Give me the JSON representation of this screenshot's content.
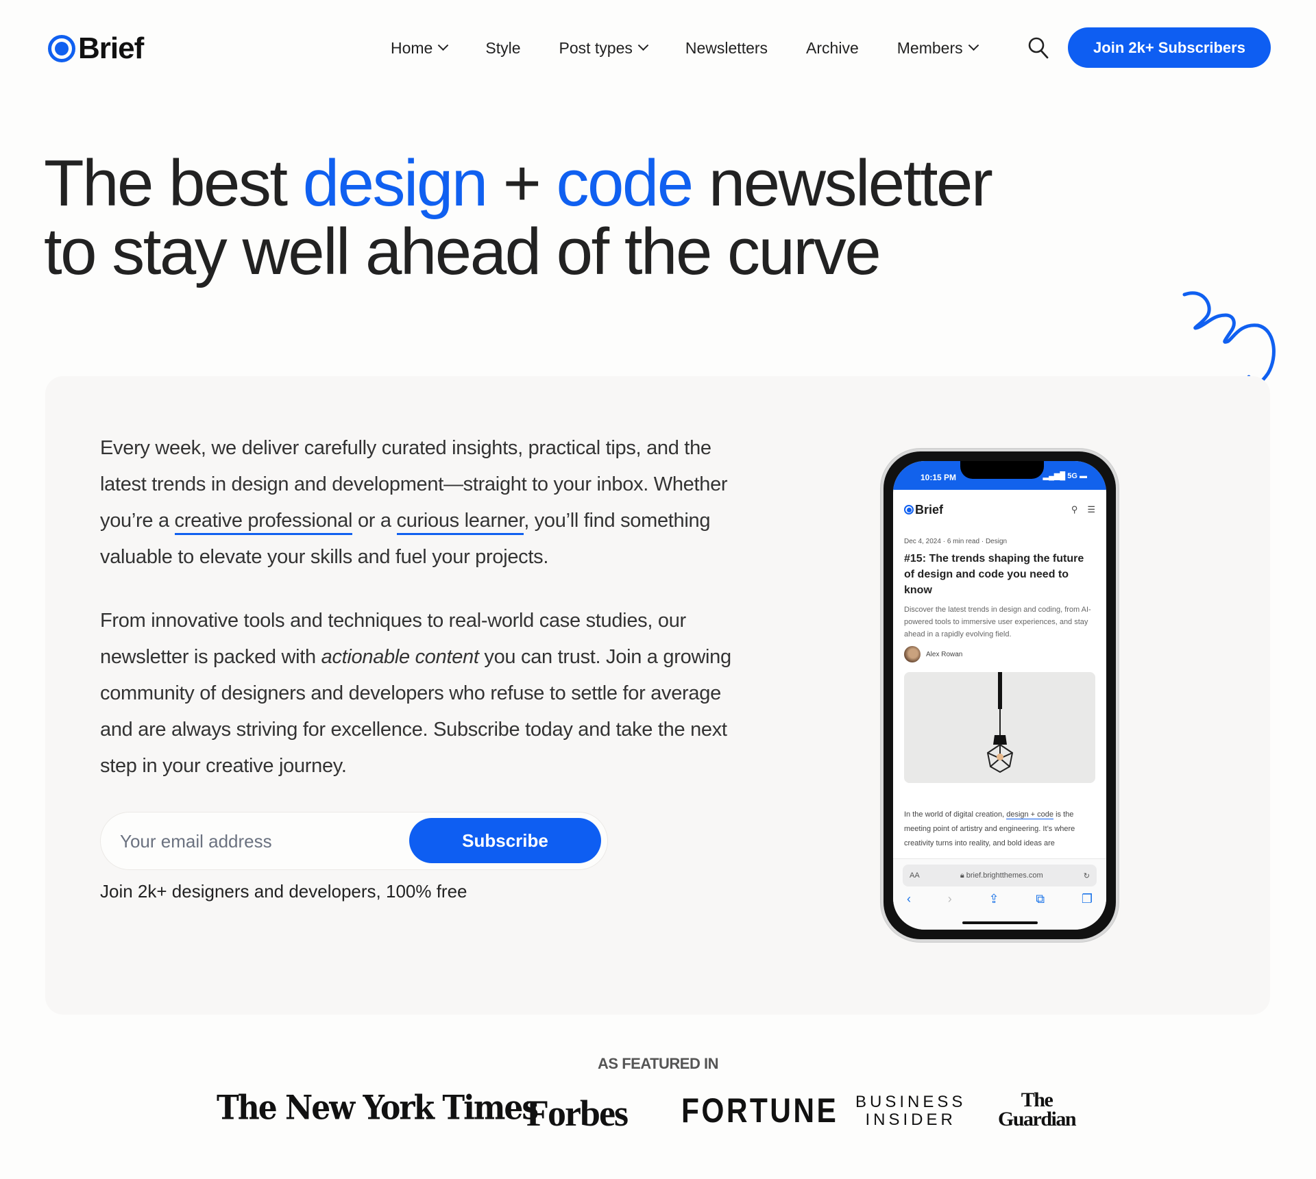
{
  "header": {
    "logo_text": "Brief",
    "nav": [
      {
        "label": "Home",
        "dropdown": true
      },
      {
        "label": "Style",
        "dropdown": false
      },
      {
        "label": "Post types",
        "dropdown": true
      },
      {
        "label": "Newsletters",
        "dropdown": false
      },
      {
        "label": "Archive",
        "dropdown": false
      },
      {
        "label": "Members",
        "dropdown": true
      }
    ],
    "search_icon": "search-icon",
    "cta_label": "Join 2k+ Subscribers"
  },
  "hero": {
    "line1_a": "The best ",
    "line1_b": "design",
    "line1_c": " + ",
    "line1_d": "code",
    "line1_e": " newsletter",
    "line2": "to stay well ahead of the curve"
  },
  "intro": {
    "p1_a": "Every week, we deliver carefully curated insights, practical tips, and the latest trends in design and development—straight to your inbox. Whether you’re a ",
    "p1_link1": "creative professional",
    "p1_b": " or a ",
    "p1_link2": "curious learner",
    "p1_c": ", you’ll find something valuable to elevate your skills and fuel your projects.",
    "p2_a": "From innovative tools and techniques to real-world case studies, our newsletter is packed with ",
    "p2_em": "actionable content",
    "p2_b": " you can trust. Join a growing community of designers and developers who refuse to settle for average and are always striving for excellence. Subscribe today and take the next step in your creative journey."
  },
  "form": {
    "email_placeholder": "Your email address",
    "email_value": "",
    "subscribe_label": "Subscribe",
    "note": "Join 2k+ designers and developers, 100% free"
  },
  "phone": {
    "time": "10:15 PM",
    "signal": "5G",
    "logo_text": "Brief",
    "meta": "Dec 4, 2024 · 6 min read · Design",
    "title": "#15: The trends shaping the future of design and code you need to know",
    "excerpt": "Discover the latest trends in design and coding, from AI-powered tools to immersive user experiences, and stay ahead in a rapidly evolving field.",
    "author": "Alex Rowan",
    "body_a": "In the world of digital creation, ",
    "body_link": "design + code",
    "body_b": " is the meeting point of artistry and engineering. It’s where creativity turns into reality, and bold ideas are",
    "url_aa": "AA",
    "url": "brief.brightthemes.com"
  },
  "featured": {
    "heading": "AS FEATURED IN",
    "logos": [
      "The New York Times",
      "Forbes",
      "FORTUNE",
      "BUSINESS INSIDER",
      "The Guardian"
    ],
    "bi_line1": "BUSINESS",
    "bi_line2": "INSIDER",
    "guardian_line1": "The",
    "guardian_line2": "Guardian"
  },
  "colors": {
    "accent": "#0e5ef2",
    "text": "#222222",
    "card_bg": "#f8f7f6",
    "page_bg": "#fdfdfc"
  }
}
